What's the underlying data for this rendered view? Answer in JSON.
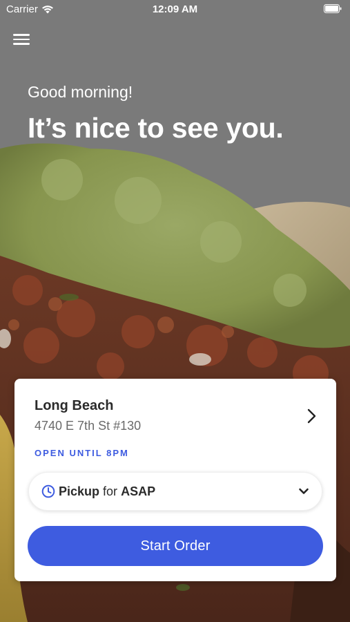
{
  "status_bar": {
    "carrier": "Carrier",
    "time": "12:09 AM"
  },
  "header": {
    "menu_icon": "hamburger-menu-icon",
    "greeting": "Good morning!",
    "headline": "It’s nice to see you."
  },
  "hero": {
    "subject": "food-photo"
  },
  "location_card": {
    "store_name": "Long Beach",
    "address": "4740 E 7th St #130",
    "open_status": "OPEN UNTIL 8PM",
    "pickup": {
      "mode": "Pickup",
      "connector": "for",
      "time": "ASAP"
    },
    "start_button": "Start Order"
  },
  "colors": {
    "accent": "#3e5ce0",
    "card_bg": "#ffffff",
    "overlay": "#7a7a7a"
  }
}
